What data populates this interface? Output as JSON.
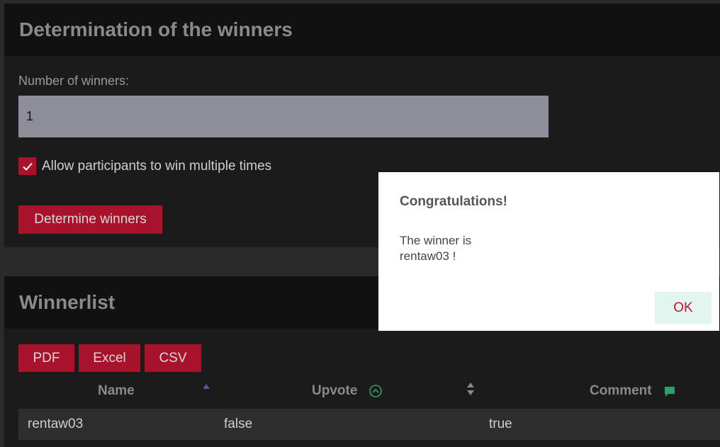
{
  "determination": {
    "title": "Determination of the winners",
    "number_label": "Number of winners:",
    "number_value": "1",
    "allow_multiple_label": "Allow participants to win multiple times",
    "allow_multiple_checked": true,
    "determine_button": "Determine winners"
  },
  "winnerlist": {
    "title": "Winnerlist",
    "export_buttons": [
      "PDF",
      "Excel",
      "CSV"
    ],
    "columns": [
      "Name",
      "Upvote",
      "Comment"
    ],
    "rows": [
      {
        "name": "rentaw03",
        "upvote": "false",
        "comment": "true"
      }
    ]
  },
  "dialog": {
    "title": "Congratulations!",
    "message_line1": "The winner is",
    "message_line2": "rentaw03 !",
    "ok_label": "OK"
  },
  "colors": {
    "accent": "#a8132b",
    "upvote_icon": "#2f9e6e",
    "comment_icon": "#2f9e6e"
  }
}
